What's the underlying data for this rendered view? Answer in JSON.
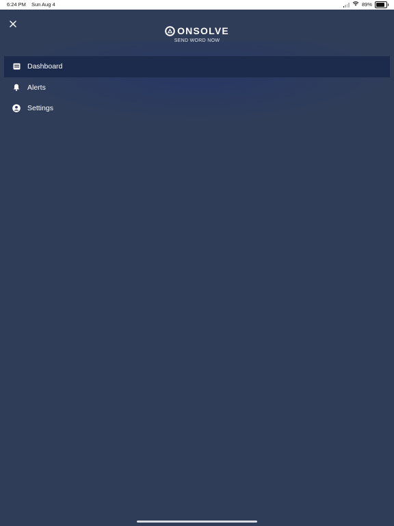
{
  "status_bar": {
    "time": "6:24 PM",
    "date": "Sun Aug 4",
    "battery_percent": "89%",
    "battery_level": 0.89,
    "icons": [
      "signal-icon",
      "wifi-icon",
      "battery-icon"
    ]
  },
  "header": {
    "close_icon": "close-icon",
    "logo_text": "ONSOLVE",
    "tagline": "SEND WORD NOW"
  },
  "menu": {
    "items": [
      {
        "label": "Dashboard",
        "icon": "dashboard-icon",
        "active": true
      },
      {
        "label": "Alerts",
        "icon": "bell-icon",
        "active": false
      },
      {
        "label": "Settings",
        "icon": "user-circle-icon",
        "active": false
      }
    ]
  },
  "colors": {
    "background": "#303d59",
    "active_item": "#1c2a4b",
    "text": "#ffffff"
  }
}
